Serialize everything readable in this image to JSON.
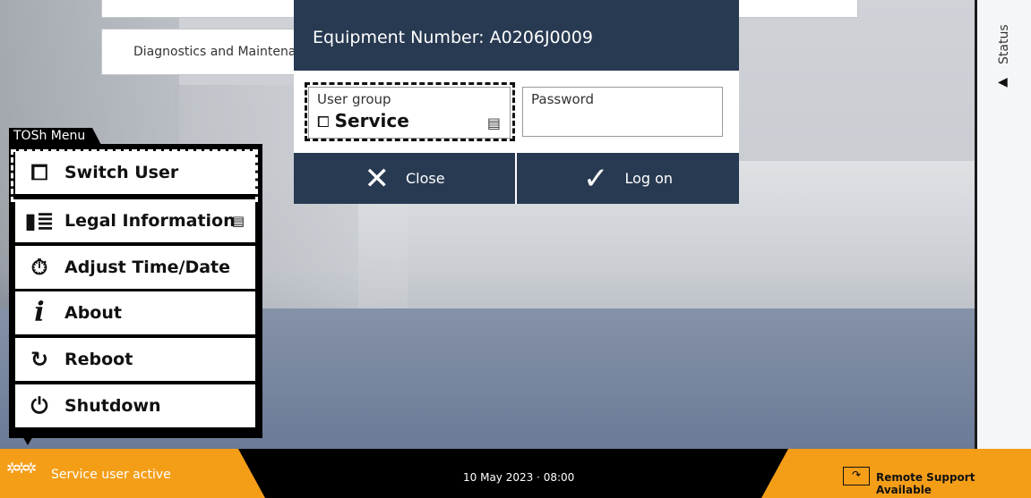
{
  "background": {
    "tile_top_text": "",
    "tile_diag_text": "Diagnostics and Maintena"
  },
  "status_panel": {
    "label": "Status",
    "arrow_icon": "triangle-left-icon"
  },
  "dialog": {
    "title": "Equipment Number: A0206J0009",
    "user_group_label": "User group",
    "user_group_value": "Service",
    "user_group_icon": "user-key-icon",
    "password_label": "Password",
    "password_value": "",
    "close_label": "Close",
    "logon_label": "Log on"
  },
  "menu": {
    "tab_label": "TOSh Menu",
    "items": [
      {
        "label": "Switch User",
        "icon": "switch-user-icon"
      },
      {
        "label": "Legal Information",
        "icon": "document-icon"
      },
      {
        "label": "Adjust Time/Date",
        "icon": "stopwatch-icon"
      },
      {
        "label": "About",
        "icon": "info-icon"
      },
      {
        "label": "Reboot",
        "icon": "reboot-icon"
      },
      {
        "label": "Shutdown",
        "icon": "power-icon"
      }
    ]
  },
  "bottombar": {
    "user_status": "Service user active",
    "datetime": "10 May 2023 · 08:00",
    "remote_support": "Remote Support Available"
  },
  "colors": {
    "accent_orange": "#f49e18",
    "dialog_navy": "#283a52"
  }
}
